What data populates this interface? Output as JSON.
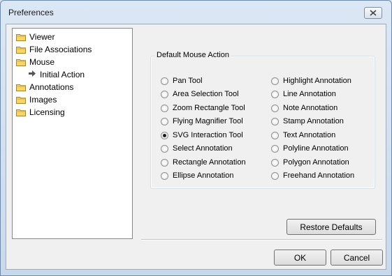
{
  "window": {
    "title": "Preferences"
  },
  "tree": {
    "items": [
      {
        "label": "Viewer",
        "icon": "folder-icon"
      },
      {
        "label": "File Associations",
        "icon": "folder-icon"
      },
      {
        "label": "Mouse",
        "icon": "folder-icon"
      },
      {
        "label": "Initial Action",
        "icon": "arrow-right-icon"
      },
      {
        "label": "Annotations",
        "icon": "folder-icon"
      },
      {
        "label": "Images",
        "icon": "folder-icon"
      },
      {
        "label": "Licensing",
        "icon": "folder-icon"
      }
    ]
  },
  "group": {
    "title": "Default Mouse Action",
    "left_options": [
      "Pan Tool",
      "Area Selection Tool",
      "Zoom Rectangle Tool",
      "Flying Magnifier Tool",
      "SVG Interaction Tool",
      "Select Annotation",
      "Rectangle Annotation",
      "Ellipse Annotation"
    ],
    "right_options": [
      "Highlight Annotation",
      "Line Annotation",
      "Note Annotation",
      "Stamp Annotation",
      "Text Annotation",
      "Polyline Annotation",
      "Polygon Annotation",
      "Freehand Annotation"
    ],
    "selected": "SVG Interaction Tool"
  },
  "buttons": {
    "restore": "Restore Defaults",
    "ok": "OK",
    "cancel": "Cancel"
  }
}
